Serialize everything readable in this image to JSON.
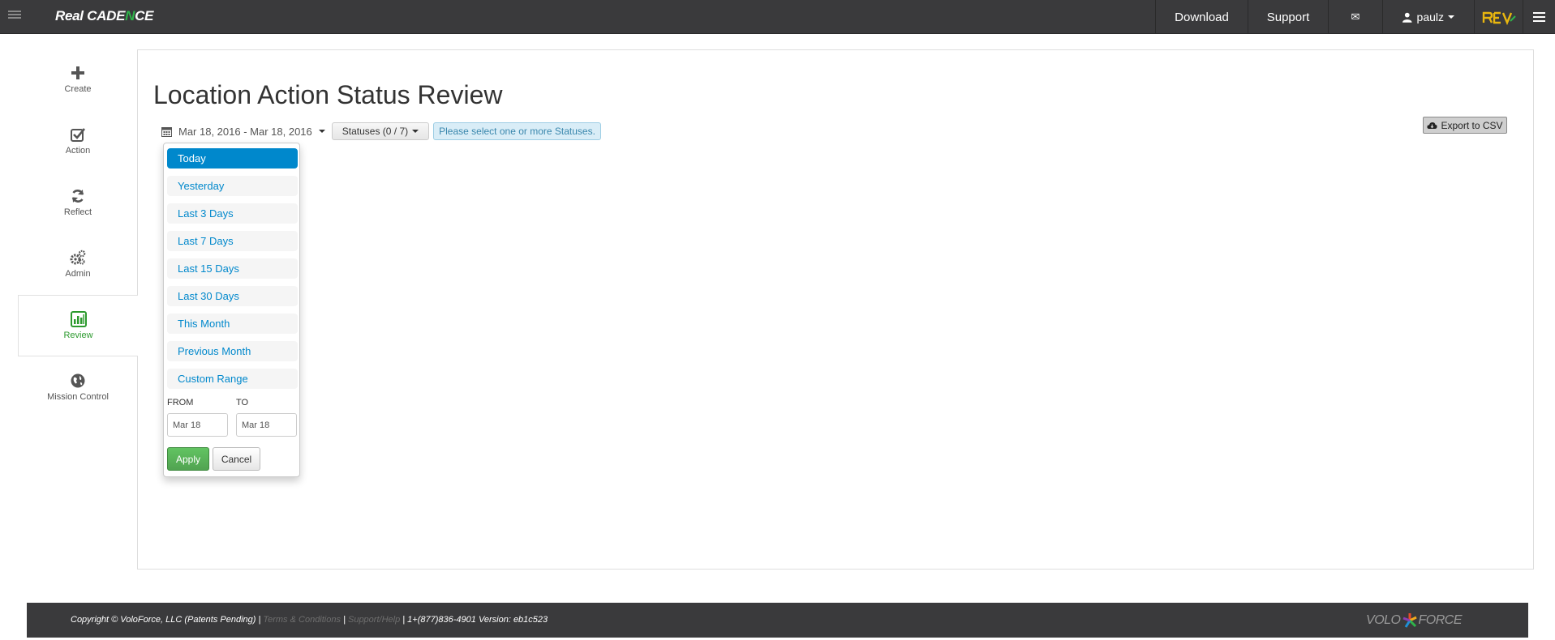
{
  "navbar": {
    "brand_part1": "Real CADE",
    "brand_accent": "N",
    "brand_part2": "CE",
    "download": "Download",
    "support": "Support",
    "mail_icon": "✉",
    "username": "paulz"
  },
  "sidebar": {
    "items": [
      {
        "label": "Create",
        "icon": "plus-icon"
      },
      {
        "label": "Action",
        "icon": "check-square-icon"
      },
      {
        "label": "Reflect",
        "icon": "refresh-icon"
      },
      {
        "label": "Admin",
        "icon": "gears-icon"
      },
      {
        "label": "Review",
        "icon": "bar-chart-icon",
        "active": true
      },
      {
        "label": "Mission Control",
        "icon": "globe-icon"
      }
    ],
    "active_color": "#2c9a2e"
  },
  "main": {
    "title": "Location Action Status Review",
    "date_range": "Mar 18, 2016 - Mar 18, 2016",
    "statuses_button": "Statuses (0 / 7)",
    "statuses_alert": "Please select one or more Statuses.",
    "export_button": "Export to CSV"
  },
  "date_picker": {
    "ranges": [
      "Today",
      "Yesterday",
      "Last 3 Days",
      "Last 7 Days",
      "Last 15 Days",
      "Last 30 Days",
      "This Month",
      "Previous Month",
      "Custom Range"
    ],
    "selected": "Today",
    "from_label": "FROM",
    "to_label": "TO",
    "from_value": "Mar 18",
    "to_value": "Mar 18",
    "apply": "Apply",
    "cancel": "Cancel",
    "active_color": "#0088cc"
  },
  "footer": {
    "copyright": "Copyright © VoloForce, LLC (Patents Pending) |",
    "terms": "Terms & Conditions",
    "sep": "|",
    "support_help": "Support/Help",
    "contact": "| 1+(877)836-4901 Version: eb1c523",
    "logo_left": "VOLO",
    "logo_right": "FORCE"
  }
}
